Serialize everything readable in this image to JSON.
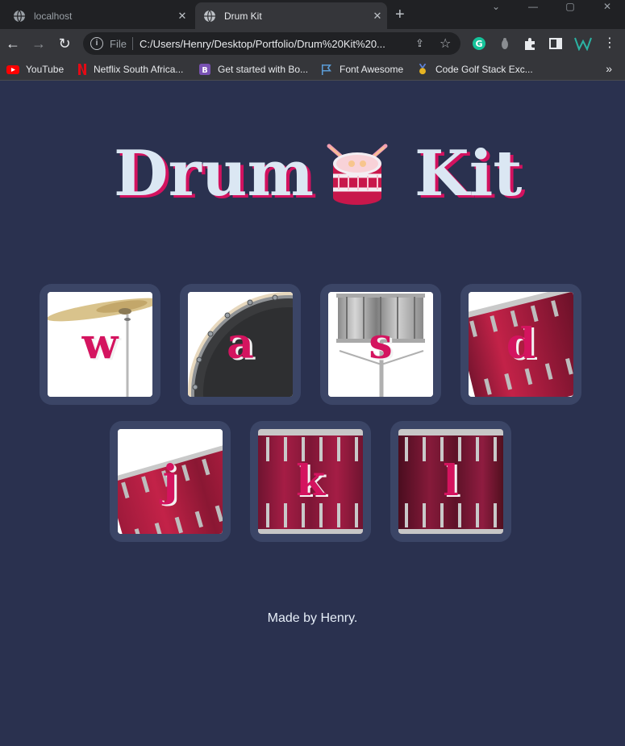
{
  "browser": {
    "tabs": [
      {
        "title": "localhost",
        "active": false
      },
      {
        "title": "Drum Kit",
        "active": true
      }
    ],
    "address": {
      "scheme": "File",
      "url": "C:/Users/Henry/Desktop/Portfolio/Drum%20Kit%20..."
    },
    "bookmarks": [
      {
        "label": "YouTube",
        "icon": "youtube-icon",
        "color": "#ff0000"
      },
      {
        "label": "Netflix South Africa...",
        "icon": "netflix-icon",
        "color": "#e50914"
      },
      {
        "label": "Get started with Bo...",
        "icon": "bootstrap-icon",
        "color": "#7952b3"
      },
      {
        "label": "Font Awesome",
        "icon": "font-awesome-icon",
        "color": "#5b9bd5"
      },
      {
        "label": "Code Golf Stack Exc...",
        "icon": "code-golf-icon",
        "color": "#e6b422"
      }
    ]
  },
  "page": {
    "title_word_1": "Drum",
    "title_word_2": "Kit",
    "keys": [
      {
        "letter": "w",
        "sound": "cymbal"
      },
      {
        "letter": "a",
        "sound": "bass-drum"
      },
      {
        "letter": "s",
        "sound": "snare"
      },
      {
        "letter": "d",
        "sound": "tom"
      },
      {
        "letter": "j",
        "sound": "tom"
      },
      {
        "letter": "k",
        "sound": "tom"
      },
      {
        "letter": "l",
        "sound": "tom"
      }
    ],
    "footer": "Made by Henry."
  },
  "colors": {
    "background": "#2a314f",
    "key_frame": "#3b4566",
    "accent": "#d4145f",
    "title": "#dbe7f3"
  }
}
